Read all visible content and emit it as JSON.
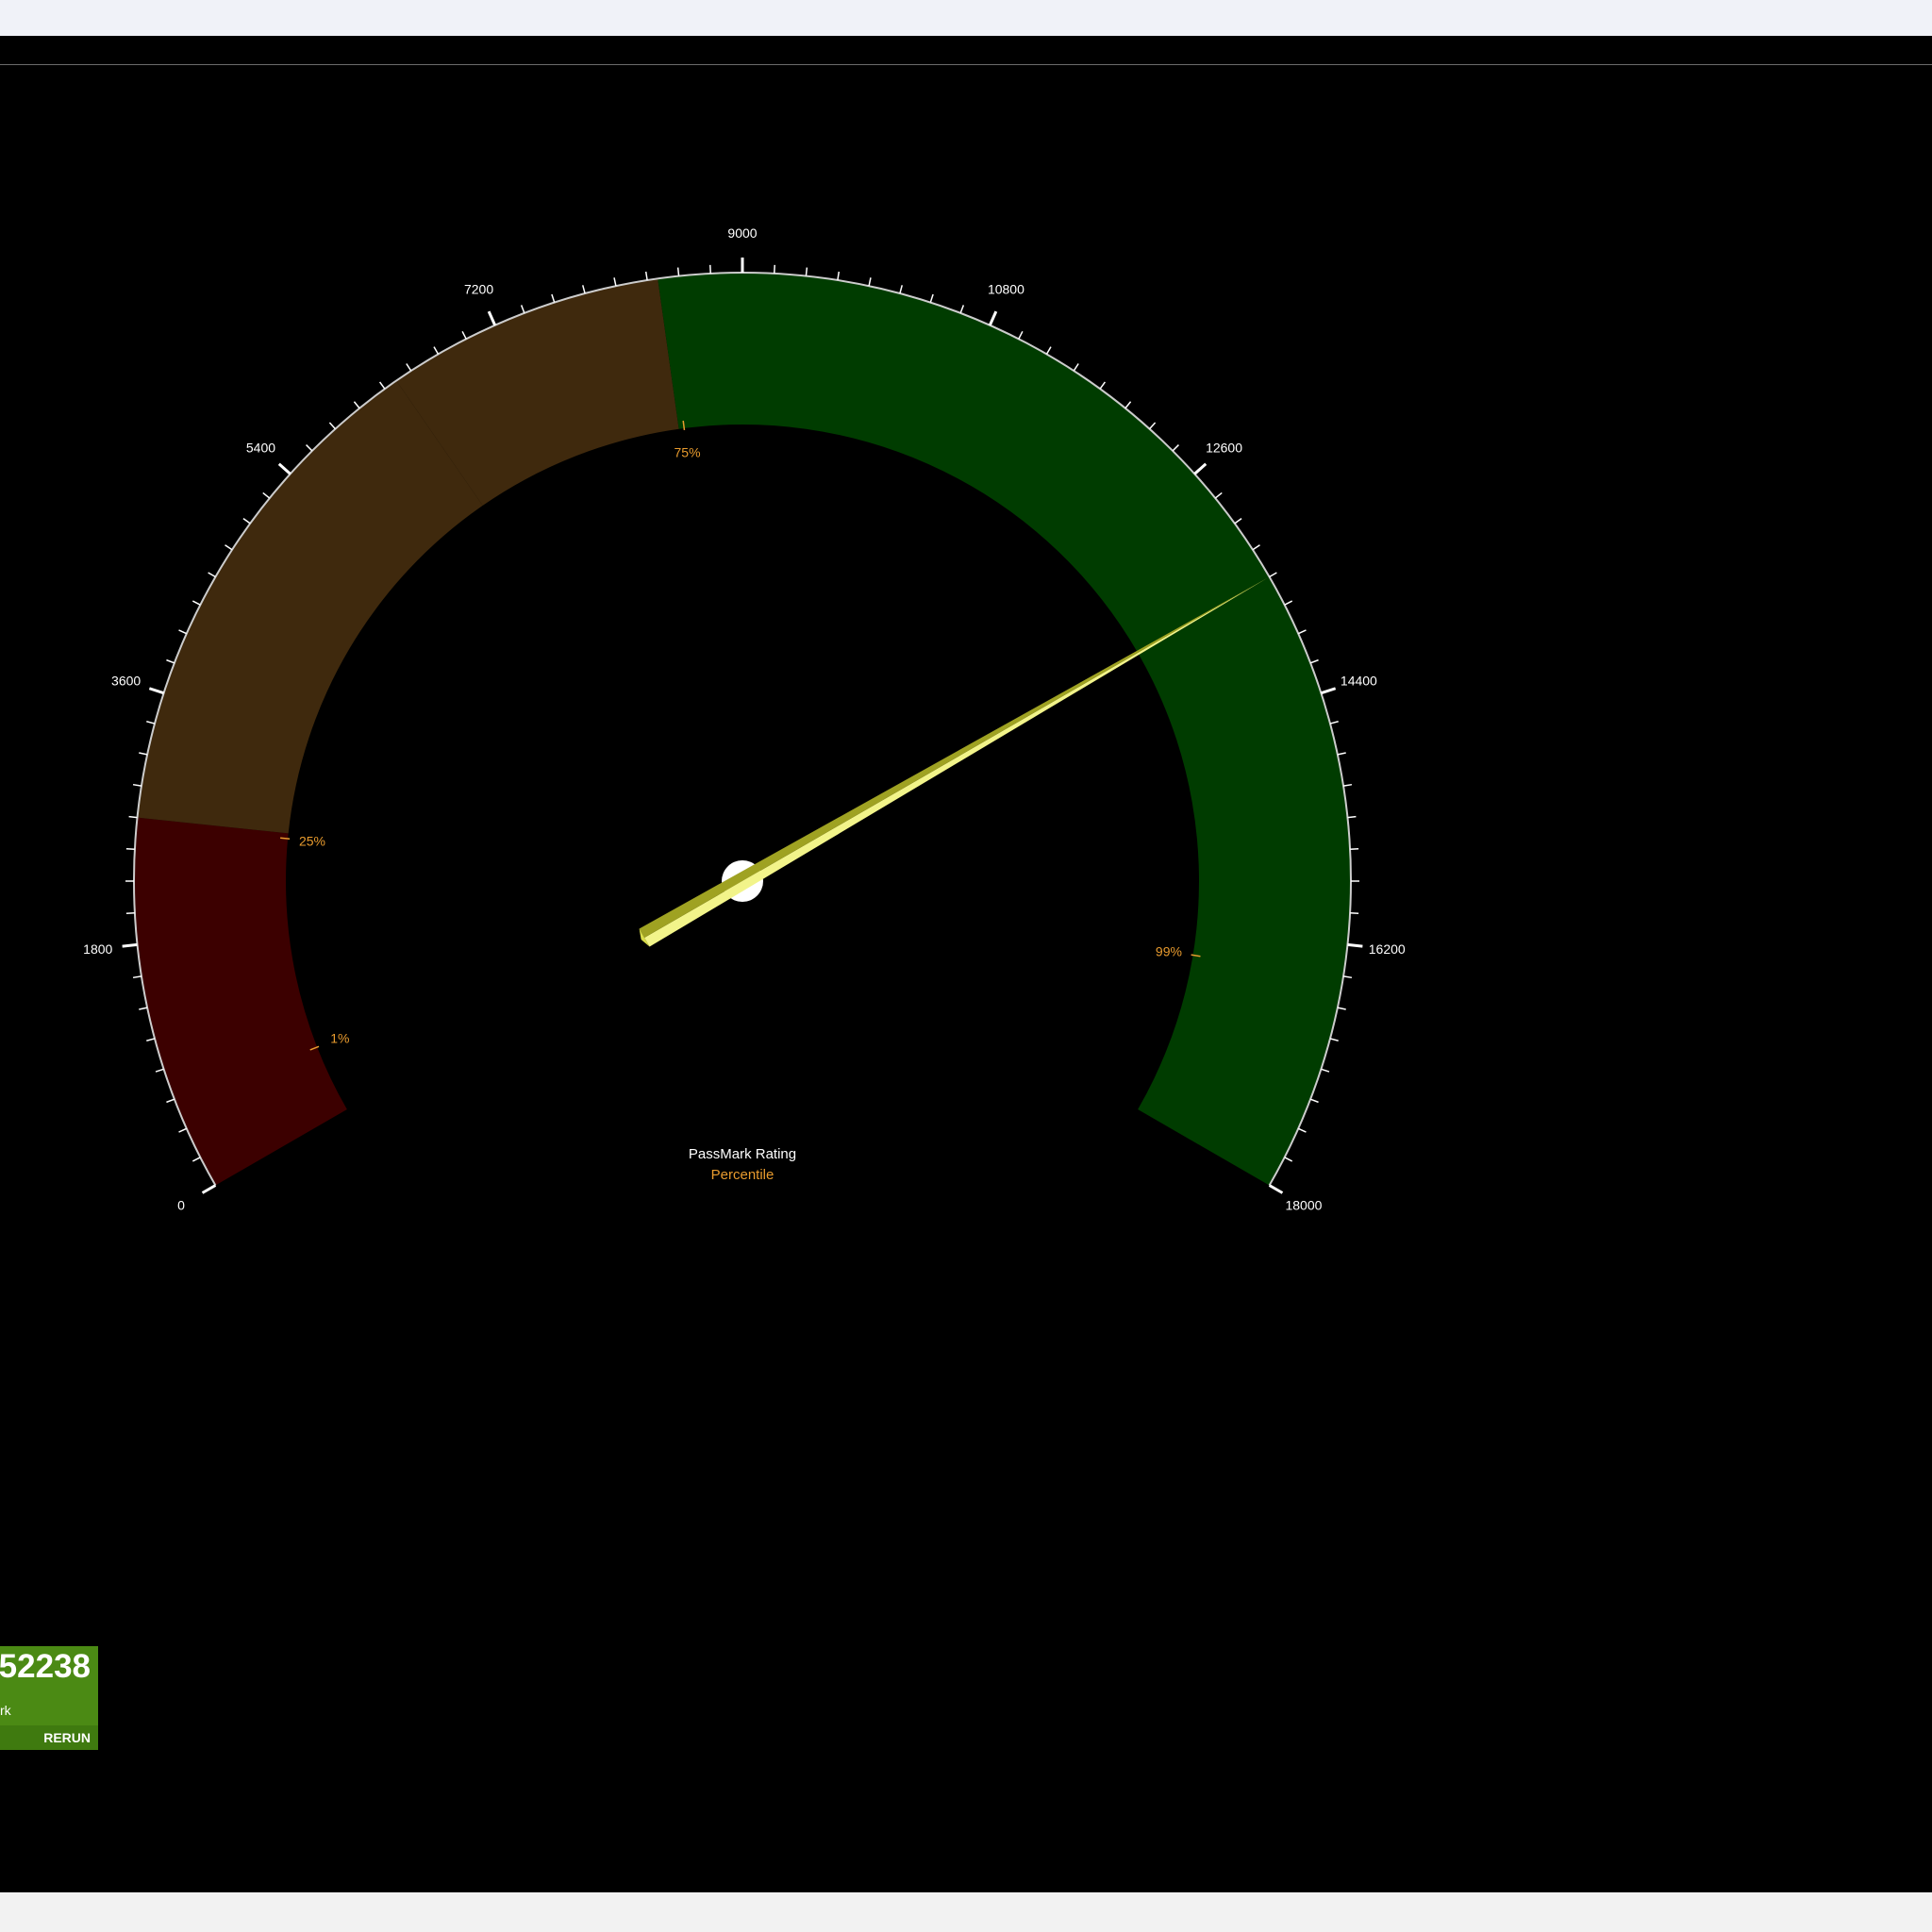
{
  "gauge": {
    "title": "PassMark Rating",
    "subtitle": "Percentile",
    "min": 0,
    "max": 18000,
    "major_step": 1800,
    "minor_per_major": 7,
    "major_labels": [
      "0",
      "1800",
      "3600",
      "5400",
      "7200",
      "9000",
      "10800",
      "12600",
      "14400",
      "16200",
      "18000"
    ],
    "needle_value": 13500,
    "bands": [
      {
        "from": 0,
        "to": 2700,
        "color": "#3c0000"
      },
      {
        "from": 2700,
        "to": 6400,
        "color": "#3f290d"
      },
      {
        "from": 6400,
        "to": 8400,
        "color": "#3f290d"
      },
      {
        "from": 8400,
        "to": 18000,
        "color": "#003c00"
      }
    ],
    "percentile_markers": [
      {
        "value": 650,
        "label": "1%"
      },
      {
        "value": 2650,
        "label": "25%"
      },
      {
        "value": 8450,
        "label": "75%"
      },
      {
        "value": 16450,
        "label": "99%"
      }
    ],
    "colors": {
      "tick": "#ffffff",
      "rim": "#cccccc",
      "label": "#ffffff",
      "percentile": "#e89b2e",
      "needle": "#d8dc48",
      "needle_light": "#f2f48a",
      "needle_dark": "#9fa222",
      "hub": "#ffffff"
    }
  },
  "tile": {
    "score": "52238",
    "subtitle": "rk",
    "button": "RERUN",
    "color": "#4b8a14"
  }
}
